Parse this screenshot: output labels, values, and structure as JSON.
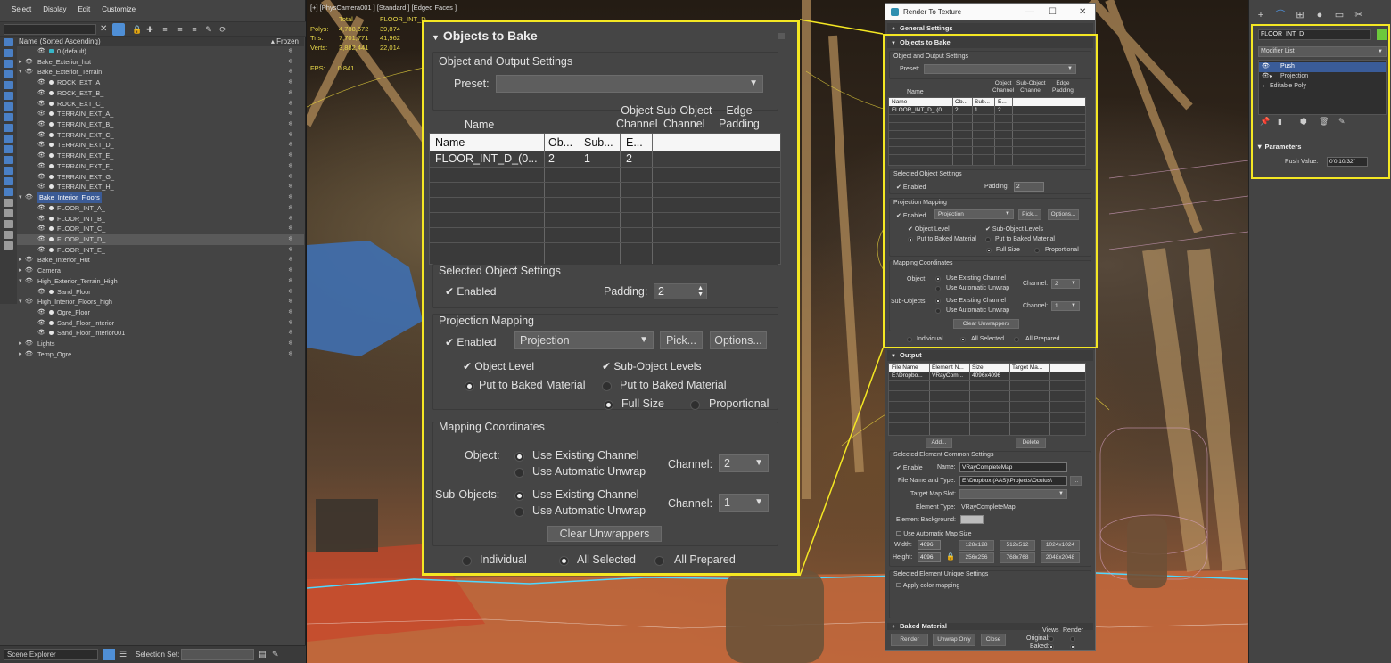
{
  "menu": [
    "Select",
    "Display",
    "Edit",
    "Customize"
  ],
  "scene_explorer": {
    "header_name": "Name (Sorted Ascending)",
    "header_frozen": "▴ Frozen",
    "tree": [
      {
        "label": "0 (default)",
        "depth": 1,
        "kind": "layer"
      },
      {
        "label": "Bake_Exterior_hut",
        "depth": 0,
        "kind": "group",
        "collapsed": true
      },
      {
        "label": "Bake_Exterior_Terrain",
        "depth": 0,
        "kind": "group",
        "collapsed": false
      },
      {
        "label": "ROCK_EXT_A_",
        "depth": 1,
        "kind": "item"
      },
      {
        "label": "ROCK_EXT_B_",
        "depth": 1,
        "kind": "item"
      },
      {
        "label": "ROCK_EXT_C_",
        "depth": 1,
        "kind": "item"
      },
      {
        "label": "TERRAIN_EXT_A_",
        "depth": 1,
        "kind": "item"
      },
      {
        "label": "TERRAIN_EXT_B_",
        "depth": 1,
        "kind": "item"
      },
      {
        "label": "TERRAIN_EXT_C_",
        "depth": 1,
        "kind": "item"
      },
      {
        "label": "TERRAIN_EXT_D_",
        "depth": 1,
        "kind": "item"
      },
      {
        "label": "TERRAIN_EXT_E_",
        "depth": 1,
        "kind": "item"
      },
      {
        "label": "TERRAIN_EXT_F_",
        "depth": 1,
        "kind": "item"
      },
      {
        "label": "TERRAIN_EXT_G_",
        "depth": 1,
        "kind": "item"
      },
      {
        "label": "TERRAIN_EXT_H_",
        "depth": 1,
        "kind": "item"
      },
      {
        "label": "Bake_Interior_Floors",
        "depth": 0,
        "kind": "group",
        "collapsed": false,
        "highlight": true
      },
      {
        "label": "FLOOR_INT_A_",
        "depth": 1,
        "kind": "item"
      },
      {
        "label": "FLOOR_INT_B_",
        "depth": 1,
        "kind": "item"
      },
      {
        "label": "FLOOR_INT_C_",
        "depth": 1,
        "kind": "item"
      },
      {
        "label": "FLOOR_INT_D_",
        "depth": 1,
        "kind": "item",
        "selected": true
      },
      {
        "label": "FLOOR_INT_E_",
        "depth": 1,
        "kind": "item"
      },
      {
        "label": "Bake_Interior_Hut",
        "depth": 0,
        "kind": "group",
        "collapsed": true,
        "noeye": true
      },
      {
        "label": "Camera",
        "depth": 0,
        "kind": "group",
        "collapsed": true
      },
      {
        "label": "High_Exterior_Terrain_High",
        "depth": 0,
        "kind": "group",
        "collapsed": false
      },
      {
        "label": "Sand_Floor",
        "depth": 1,
        "kind": "item"
      },
      {
        "label": "High_Interior_Floors_high",
        "depth": 0,
        "kind": "group",
        "collapsed": false
      },
      {
        "label": "Ogre_Floor",
        "depth": 1,
        "kind": "item"
      },
      {
        "label": "Sand_Floor_interior",
        "depth": 1,
        "kind": "item"
      },
      {
        "label": "Sand_Floor_interior001",
        "depth": 1,
        "kind": "item"
      },
      {
        "label": "Lights",
        "depth": 0,
        "kind": "group",
        "collapsed": true
      },
      {
        "label": "Temp_Ogre",
        "depth": 0,
        "kind": "group",
        "collapsed": true
      }
    ],
    "bottom_name": "Scene Explorer",
    "selection_set_label": "Selection Set:"
  },
  "viewport": {
    "label": "[+] [PhysCamera001 ] [Standard ] [Edged Faces ]",
    "stats_header": [
      "",
      "Total",
      "FLOOR_INT_D_"
    ],
    "stats": [
      {
        "name": "Polys:",
        "total": "4,788,672",
        "sel": "39,874"
      },
      {
        "name": "Tris:",
        "total": "7,701,771",
        "sel": "41,962"
      },
      {
        "name": "Verts:",
        "total": "3,882,441",
        "sel": "22,014"
      }
    ],
    "fps_label": "FPS:",
    "fps_value": "0.841"
  },
  "zoom": {
    "title": "Objects to Bake",
    "sec_output": "Object and Output Settings",
    "preset_label": "Preset:",
    "col_name": "Name",
    "col_object_channel": [
      "Object",
      "Channel"
    ],
    "col_subobject_channel": [
      "Sub-Object",
      "Channel"
    ],
    "col_edge_padding": [
      "Edge",
      "Padding"
    ],
    "table_header": [
      "Name",
      "Ob...",
      "Sub...",
      "E..."
    ],
    "table_row": [
      "FLOOR_INT_D_(0...",
      "2",
      "1",
      "2"
    ],
    "sec_selected": "Selected Object Settings",
    "enabled": "Enabled",
    "padding_label": "Padding:",
    "padding_value": "2",
    "sec_projection": "Projection Mapping",
    "proj_enabled": "Enabled",
    "projection_value": "Projection",
    "pick": "Pick...",
    "options": "Options...",
    "object_level": "Object Level",
    "subobject_levels": "Sub-Object Levels",
    "put_baked_1": "Put to Baked Material",
    "put_baked_2": "Put to Baked Material",
    "full_size": "Full Size",
    "proportional": "Proportional",
    "sec_mapping": "Mapping Coordinates",
    "object_label": "Object:",
    "subobjects_label": "Sub-Objects:",
    "use_existing": "Use Existing Channel",
    "use_auto": "Use Automatic Unwrap",
    "use_existing_2": "Use Existing Channel",
    "use_auto_2": "Use Automatic Unwrap",
    "channel_label": "Channel:",
    "channel_obj": "2",
    "channel_label_2": "Channel:",
    "channel_sub": "1",
    "clear_unwrappers": "Clear Unwrappers",
    "individual": "Individual",
    "all_selected": "All Selected",
    "all_prepared": "All Prepared"
  },
  "rtt": {
    "window_title": "Render To Texture",
    "general_settings": "General Settings",
    "objects_to_bake": "Objects to Bake",
    "sec_output": "Object and Output Settings",
    "preset_label": "Preset:",
    "col_name": "Name",
    "col_object_channel": [
      "Object",
      "Channel"
    ],
    "col_subobject_channel": [
      "Sub-Object",
      "Channel"
    ],
    "col_edge_padding": [
      "Edge",
      "Padding"
    ],
    "table_header": [
      "Name",
      "Ob...",
      "Sub...",
      "E..."
    ],
    "table_row": [
      "FLOOR_INT_D_ (0...",
      "2",
      "1",
      "2"
    ],
    "sec_selected": "Selected Object Settings",
    "enabled": "Enabled",
    "padding_label": "Padding:",
    "padding_value": "2",
    "sec_projection": "Projection Mapping",
    "proj_enabled": "Enabled",
    "projection_value": "Projection",
    "pick": "Pick...",
    "options": "Options...",
    "object_level": "Object Level",
    "subobject_levels": "Sub-Object Levels",
    "put_baked_1": "Put to Baked Material",
    "put_baked_2": "Put to Baked Material",
    "full_size": "Full Size",
    "proportional": "Proportional",
    "sec_mapping": "Mapping Coordinates",
    "object_label": "Object:",
    "subobjects_label": "Sub-Objects:",
    "use_existing": "Use Existing Channel",
    "use_auto": "Use Automatic Unwrap",
    "use_existing_2": "Use Existing Channel",
    "use_auto_2": "Use Automatic Unwrap",
    "channel_label": "Channel:",
    "channel_obj": "2",
    "channel_label_2": "Channel:",
    "channel_sub": "1",
    "clear_unwrappers": "Clear Unwrappers",
    "individual": "Individual",
    "all_selected": "All Selected",
    "all_prepared": "All Prepared",
    "output": "Output",
    "out_header": [
      "File Name",
      "Element N...",
      "Size",
      "Target Ma..."
    ],
    "out_row": [
      "E:\\Dropbo...",
      "VRayCom...",
      "4096x4096",
      ""
    ],
    "add": "Add...",
    "delete": "Delete",
    "sec_common": "Selected Element Common Settings",
    "enable": "Enable",
    "name_label": "Name:",
    "name_value": "VRayCompleteMap",
    "file_label": "File Name and Type:",
    "file_value": "E:\\Dropbox (AAS)\\Projects\\Oculus\\",
    "file_btn": "...",
    "target_slot_label": "Target Map Slot:",
    "element_type_label": "Element Type:",
    "element_type_value": "VRayCompleteMap",
    "element_bg_label": "Element Background:",
    "use_auto_size": "Use Automatic Map Size",
    "width_label": "Width:",
    "width_value": "4096",
    "height_label": "Height:",
    "height_value": "4096",
    "size_buttons": [
      "128x128",
      "512x512",
      "1024x1024",
      "256x256",
      "768x768",
      "2048x2048"
    ],
    "sec_unique": "Selected Element Unique Settings",
    "apply_color": "Apply color mapping",
    "baked_material": "Baked Material",
    "render": "Render",
    "unwrap_only": "Unwrap Only",
    "close": "Close",
    "views": "Views",
    "render_col": "Render",
    "original": "Original:",
    "baked": "Baked:"
  },
  "modify": {
    "object_name": "FLOOR_INT_D_",
    "object_color": "#6cc93c",
    "modifier_list": "Modifier List",
    "stack": [
      {
        "label": "Push",
        "selected": true,
        "eye": true,
        "tri": false
      },
      {
        "label": "Projection",
        "selected": false,
        "eye": true,
        "tri": true
      },
      {
        "label": "Editable Poly",
        "selected": false,
        "eye": false,
        "tri": true
      }
    ],
    "params_title": "Parameters",
    "push_label": "Push Value:",
    "push_value": "0'0 10/32\""
  },
  "colors": {
    "highlight": "#f4e723",
    "accent": "#4f8fd6",
    "selection": "#3a5c99"
  }
}
